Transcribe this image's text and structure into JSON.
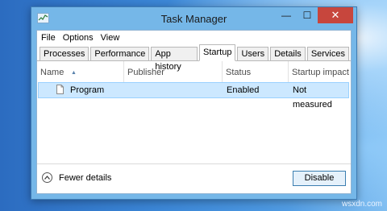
{
  "window": {
    "title": "Task Manager",
    "app_icon": "task-manager-icon",
    "controls": {
      "minimize": "—",
      "maximize": "☐",
      "close": "✕"
    }
  },
  "menu": {
    "file": "File",
    "options": "Options",
    "view": "View"
  },
  "tabs": [
    {
      "label": "Processes"
    },
    {
      "label": "Performance"
    },
    {
      "label": "App history"
    },
    {
      "label": "Startup",
      "active": true
    },
    {
      "label": "Users"
    },
    {
      "label": "Details"
    },
    {
      "label": "Services"
    }
  ],
  "columns": {
    "name": "Name",
    "publisher": "Publisher",
    "status": "Status",
    "impact": "Startup impact"
  },
  "rows": [
    {
      "name": "Program",
      "publisher": "",
      "status": "Enabled",
      "impact": "Not measured",
      "icon": "file-icon",
      "selected": true
    }
  ],
  "footer": {
    "fewer_details": "Fewer details",
    "disable": "Disable"
  },
  "watermark": "wsxdn.com",
  "colors": {
    "selection_bg": "#cce8ff",
    "close_button": "#c7463d",
    "window_frame": "#75b7e8"
  }
}
